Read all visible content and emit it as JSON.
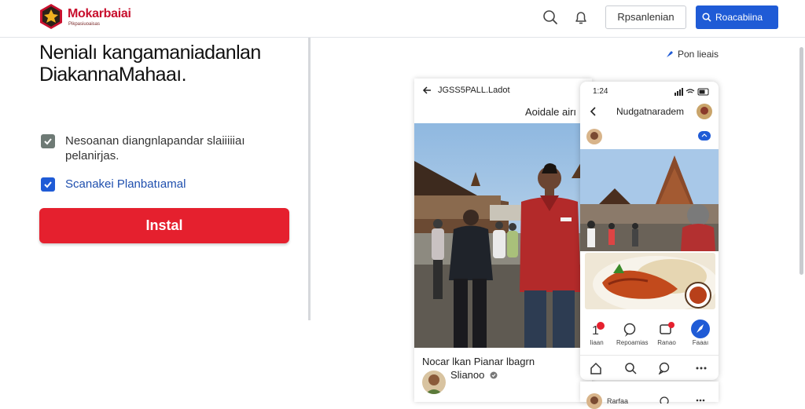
{
  "header": {
    "brand": "Mokarbaiai",
    "brand_sub": "Pikpasiuoaisas",
    "login_label": "Rpsanlenian",
    "search_label": "Roacabiina",
    "icons": [
      "search-icon",
      "notification-bell-icon"
    ],
    "accent": "#1f5bd6"
  },
  "hero": {
    "heading": "Nenialı kangamaniadanlan DiakannaMahaaı.",
    "options": [
      {
        "label": "Nesoanan diangnlapandar slaiiiiiaı pelanirjas.",
        "checked": true,
        "style": "muted"
      },
      {
        "label": "Scanakei Planbatıamal",
        "checked": true,
        "style": "primary"
      }
    ],
    "install_label": "Instal",
    "install_color": "#e5202e"
  },
  "preview": {
    "top_link": "Pon lieais",
    "post": {
      "header_title": "JGSS5PALL.Ladot",
      "sub_title": "Aoidale airı",
      "caption": "Nocar lkan Pianar lbagrn",
      "author": "Slianoo"
    },
    "phone": {
      "time": "1:24",
      "nav_title": "Nudgatnaradem",
      "actions": [
        {
          "icon": "like-icon",
          "label": "Iiaan"
        },
        {
          "icon": "comment-icon",
          "label": "Repoamias"
        },
        {
          "icon": "chat-icon",
          "label": "Ranao"
        },
        {
          "icon": "share-icon",
          "label": "Faaaı"
        }
      ],
      "tabs": [
        "home-icon",
        "search-icon",
        "chat-icon",
        "more-icon"
      ],
      "under_card_label": "Rarfaa"
    }
  }
}
